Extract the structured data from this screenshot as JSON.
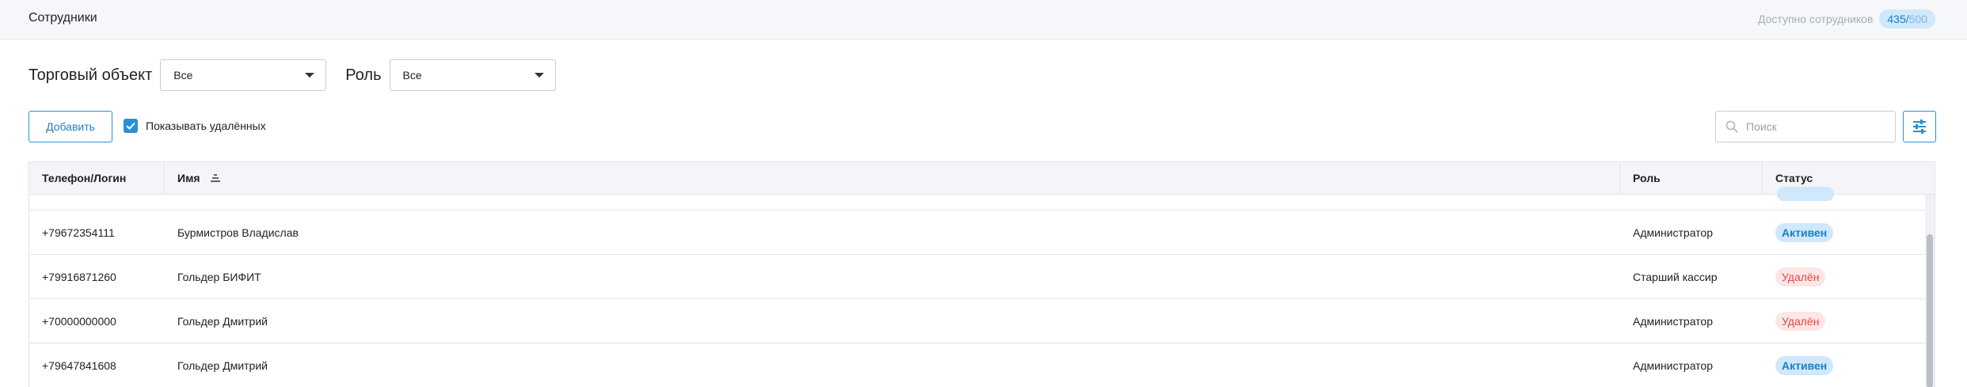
{
  "header": {
    "title": "Сотрудники",
    "available_label": "Доступно сотрудников",
    "used": "435",
    "separator": "/",
    "total": "500"
  },
  "filters": {
    "outlet_label": "Торговый объект",
    "outlet_value": "Все",
    "role_label": "Роль",
    "role_value": "Все"
  },
  "toolbar": {
    "add_label": "Добавить",
    "show_deleted_label": "Показывать удалённых",
    "show_deleted_checked": true,
    "search_placeholder": "Поиск"
  },
  "table": {
    "columns": [
      "Телефон/Логин",
      "Имя",
      "Роль",
      "Статус"
    ],
    "rows": [
      {
        "phone": "+79672354111",
        "name": "Бурмистров Владислав",
        "role": "Администратор",
        "status": "Активен",
        "status_kind": "active"
      },
      {
        "phone": "+79916871260",
        "name": "Гольдер БИФИТ",
        "role": "Старший кассир",
        "status": "Удалён",
        "status_kind": "deleted"
      },
      {
        "phone": "+70000000000",
        "name": "Гольдер Дмитрий",
        "role": "Администратор",
        "status": "Удалён",
        "status_kind": "deleted"
      },
      {
        "phone": "+79647841608",
        "name": "Гольдер Дмитрий",
        "role": "Администратор",
        "status": "Активен",
        "status_kind": "active"
      }
    ]
  },
  "colors": {
    "accent": "#2a8fd6",
    "active_badge_bg": "#cfe8fb",
    "deleted_badge_bg": "#fde6e6",
    "deleted_text": "#e04848"
  },
  "icons": {
    "search": "search-icon",
    "settings": "filter-settings-icon",
    "sort": "sort-icon",
    "check": "check-icon",
    "caret": "chevron-down-icon"
  }
}
